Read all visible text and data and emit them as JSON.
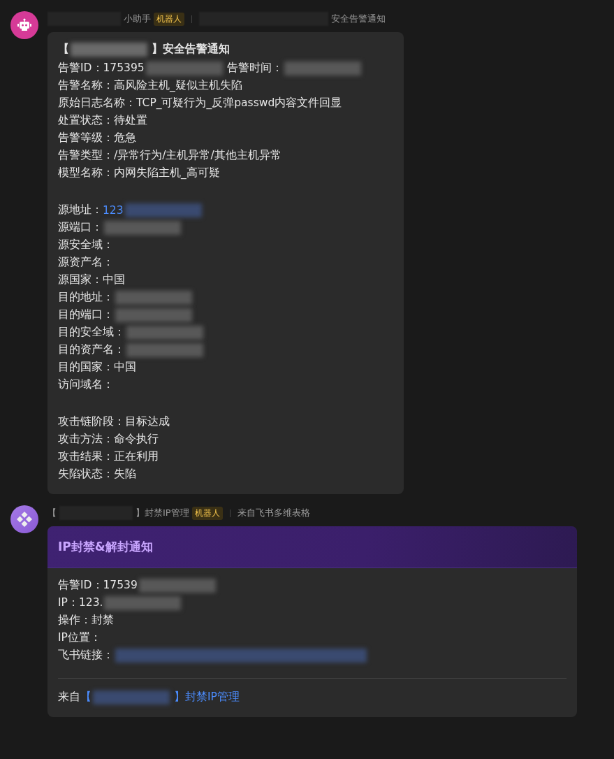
{
  "messages": [
    {
      "kind": "robot",
      "header": [
        {
          "kind": "redacted"
        },
        {
          "kind": "name",
          "text": "小助手"
        },
        {
          "kind": "badge",
          "text": "机器人"
        },
        {
          "kind": "divider"
        },
        {
          "kind": "redacted_long"
        },
        {
          "kind": "name",
          "text": "安全告警通知"
        }
      ],
      "card": {
        "kind": "plain",
        "title": [
          {
            "kind": "text",
            "text": "【"
          },
          {
            "kind": "redacted"
          },
          {
            "kind": "text",
            "text": "】安全告警通知"
          }
        ],
        "sections": [
          [
            {
              "segments": [
                {
                  "kind": "text",
                  "text": "告警ID：175395"
                },
                {
                  "kind": "redacted"
                },
                {
                  "kind": "text",
                  "text": "告警时间："
                },
                {
                  "kind": "redacted"
                }
              ]
            },
            {
              "segments": [
                {
                  "kind": "text",
                  "text": "告警名称：高风险主机_疑似主机失陷"
                }
              ]
            },
            {
              "segments": [
                {
                  "kind": "text",
                  "text": "原始日志名称：TCP_可疑行为_反弹passwd内容文件回显"
                }
              ]
            },
            {
              "segments": [
                {
                  "kind": "text",
                  "text": "处置状态：待处置"
                }
              ]
            },
            {
              "segments": [
                {
                  "kind": "text",
                  "text": "告警等级：危急"
                }
              ]
            },
            {
              "segments": [
                {
                  "kind": "text",
                  "text": "告警类型：/异常行为/主机异常/其他主机异常"
                }
              ]
            },
            {
              "segments": [
                {
                  "kind": "text",
                  "text": "模型名称：内网失陷主机_高可疑"
                }
              ]
            }
          ],
          [
            {
              "segments": [
                {
                  "kind": "text",
                  "text": "源地址："
                },
                {
                  "kind": "link",
                  "text": "123"
                },
                {
                  "kind": "redacted_link"
                }
              ]
            },
            {
              "segments": [
                {
                  "kind": "text",
                  "text": "源端口："
                },
                {
                  "kind": "redacted"
                }
              ]
            },
            {
              "segments": [
                {
                  "kind": "text",
                  "text": "源安全域："
                }
              ]
            },
            {
              "segments": [
                {
                  "kind": "text",
                  "text": "源资产名："
                }
              ]
            },
            {
              "segments": [
                {
                  "kind": "text",
                  "text": "源国家：中国"
                }
              ]
            },
            {
              "segments": [
                {
                  "kind": "text",
                  "text": "目的地址："
                },
                {
                  "kind": "redacted"
                }
              ]
            },
            {
              "segments": [
                {
                  "kind": "text",
                  "text": "目的端口："
                },
                {
                  "kind": "redacted"
                }
              ]
            },
            {
              "segments": [
                {
                  "kind": "text",
                  "text": "目的安全域："
                },
                {
                  "kind": "redacted"
                }
              ]
            },
            {
              "segments": [
                {
                  "kind": "text",
                  "text": "目的资产名："
                },
                {
                  "kind": "redacted"
                }
              ]
            },
            {
              "segments": [
                {
                  "kind": "text",
                  "text": "目的国家：中国"
                }
              ]
            },
            {
              "segments": [
                {
                  "kind": "text",
                  "text": "访问域名："
                }
              ]
            }
          ],
          [
            {
              "segments": [
                {
                  "kind": "text",
                  "text": "攻击链阶段：目标达成"
                }
              ]
            },
            {
              "segments": [
                {
                  "kind": "text",
                  "text": "攻击方法：命令执行"
                }
              ]
            },
            {
              "segments": [
                {
                  "kind": "text",
                  "text": "攻击结果：正在利用"
                }
              ]
            },
            {
              "segments": [
                {
                  "kind": "text",
                  "text": "失陷状态：失陷"
                }
              ]
            }
          ]
        ]
      }
    },
    {
      "kind": "grid",
      "header": [
        {
          "kind": "name",
          "text": "【"
        },
        {
          "kind": "redacted"
        },
        {
          "kind": "name",
          "text": "】封禁IP管理"
        },
        {
          "kind": "badge",
          "text": "机器人"
        },
        {
          "kind": "divider"
        },
        {
          "kind": "name",
          "text": "来自飞书多维表格"
        }
      ],
      "card": {
        "kind": "banner",
        "title": [
          {
            "kind": "text",
            "text": "IP封禁&解封通知"
          }
        ],
        "sections": [
          [
            {
              "segments": [
                {
                  "kind": "text",
                  "text": "告警ID：17539"
                },
                {
                  "kind": "redacted"
                }
              ]
            },
            {
              "segments": [
                {
                  "kind": "text",
                  "text": "IP：123."
                },
                {
                  "kind": "redacted"
                }
              ]
            },
            {
              "segments": [
                {
                  "kind": "text",
                  "text": "操作：封禁"
                }
              ]
            },
            {
              "segments": [
                {
                  "kind": "text",
                  "text": "IP位置："
                }
              ]
            },
            {
              "segments": [
                {
                  "kind": "text",
                  "text": "飞书链接："
                },
                {
                  "kind": "redacted_long_link"
                }
              ]
            }
          ]
        ],
        "footer": [
          {
            "kind": "text",
            "text": "来自 "
          },
          {
            "kind": "link",
            "text": "【"
          },
          {
            "kind": "redacted_link"
          },
          {
            "kind": "link",
            "text": "】封禁IP管理"
          }
        ]
      }
    }
  ]
}
